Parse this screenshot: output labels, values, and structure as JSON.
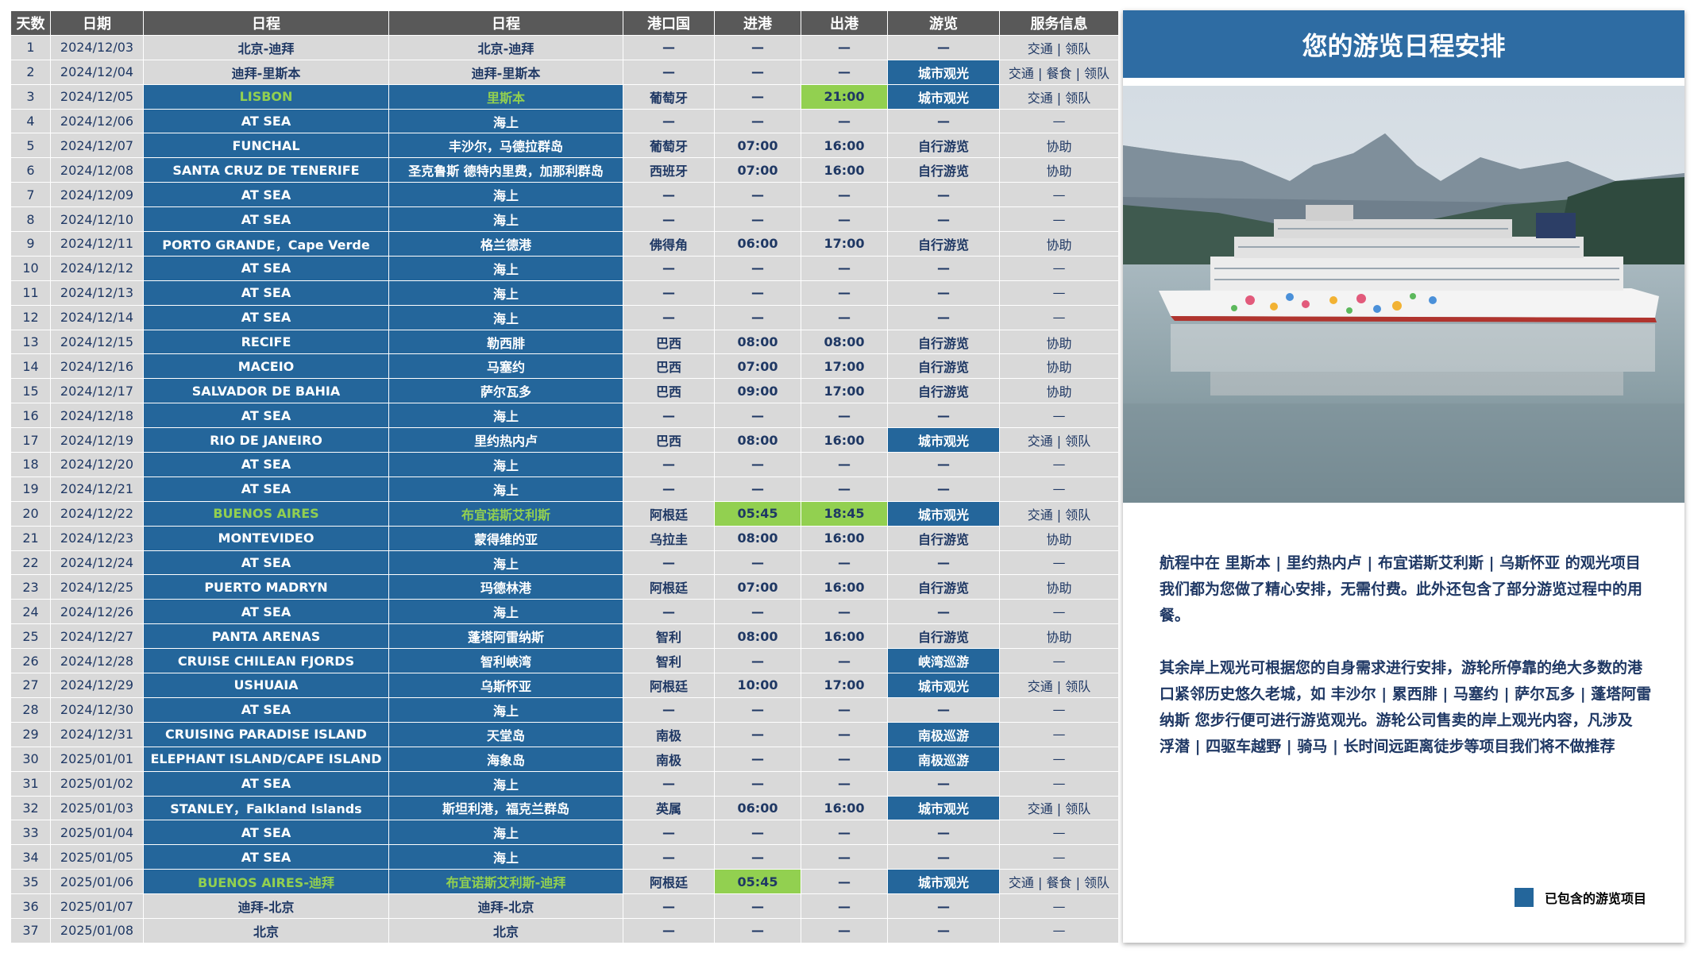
{
  "table": {
    "headers": [
      "天数",
      "日期",
      "日程",
      "日程",
      "港口国",
      "进港",
      "出港",
      "游览",
      "服务信息"
    ],
    "rows": [
      {
        "day": "1",
        "date": "2024/12/03",
        "en": "北京-迪拜",
        "cn": "北京-迪拜",
        "country": "—",
        "arrive": "—",
        "depart": "—",
        "tour": "—",
        "service": "交通 | 领队",
        "style": "plain"
      },
      {
        "day": "2",
        "date": "2024/12/04",
        "en": "迪拜-里斯本",
        "cn": "迪拜-里斯本",
        "country": "—",
        "arrive": "—",
        "depart": "—",
        "tour": "城市观光",
        "service": "交通 | 餐食 | 领队",
        "style": "plain",
        "tourHi": true
      },
      {
        "day": "3",
        "date": "2024/12/05",
        "en": "LISBON",
        "cn": "里斯本",
        "country": "葡萄牙",
        "arrive": "—",
        "depart": "21:00",
        "tour": "城市观光",
        "service": "交通 | 领队",
        "style": "highlight",
        "departHi": true,
        "tourHi": true
      },
      {
        "day": "4",
        "date": "2024/12/06",
        "en": "AT SEA",
        "cn": "海上",
        "country": "—",
        "arrive": "—",
        "depart": "—",
        "tour": "—",
        "service": "—",
        "style": "sea"
      },
      {
        "day": "5",
        "date": "2024/12/07",
        "en": "FUNCHAL",
        "cn": "丰沙尔，马德拉群岛",
        "country": "葡萄牙",
        "arrive": "07:00",
        "depart": "16:00",
        "tour": "自行游览",
        "service": "协助",
        "style": "sea"
      },
      {
        "day": "6",
        "date": "2024/12/08",
        "en": "SANTA CRUZ DE TENERIFE",
        "cn": "圣克鲁斯 德特内里费，加那利群岛",
        "country": "西班牙",
        "arrive": "07:00",
        "depart": "16:00",
        "tour": "自行游览",
        "service": "协助",
        "style": "sea"
      },
      {
        "day": "7",
        "date": "2024/12/09",
        "en": "AT SEA",
        "cn": "海上",
        "country": "—",
        "arrive": "—",
        "depart": "—",
        "tour": "—",
        "service": "—",
        "style": "sea"
      },
      {
        "day": "8",
        "date": "2024/12/10",
        "en": "AT SEA",
        "cn": "海上",
        "country": "—",
        "arrive": "—",
        "depart": "—",
        "tour": "—",
        "service": "—",
        "style": "sea"
      },
      {
        "day": "9",
        "date": "2024/12/11",
        "en": "PORTO GRANDE，Cape Verde",
        "cn": "格兰德港",
        "country": "佛得角",
        "arrive": "06:00",
        "depart": "17:00",
        "tour": "自行游览",
        "service": "协助",
        "style": "sea"
      },
      {
        "day": "10",
        "date": "2024/12/12",
        "en": "AT SEA",
        "cn": "海上",
        "country": "—",
        "arrive": "—",
        "depart": "—",
        "tour": "—",
        "service": "—",
        "style": "sea"
      },
      {
        "day": "11",
        "date": "2024/12/13",
        "en": "AT SEA",
        "cn": "海上",
        "country": "—",
        "arrive": "—",
        "depart": "—",
        "tour": "—",
        "service": "—",
        "style": "sea"
      },
      {
        "day": "12",
        "date": "2024/12/14",
        "en": "AT SEA",
        "cn": "海上",
        "country": "—",
        "arrive": "—",
        "depart": "—",
        "tour": "—",
        "service": "—",
        "style": "sea"
      },
      {
        "day": "13",
        "date": "2024/12/15",
        "en": "RECIFE",
        "cn": "勒西腓",
        "country": "巴西",
        "arrive": "08:00",
        "depart": "08:00",
        "tour": "自行游览",
        "service": "协助",
        "style": "sea"
      },
      {
        "day": "14",
        "date": "2024/12/16",
        "en": "MACEIO",
        "cn": "马塞约",
        "country": "巴西",
        "arrive": "07:00",
        "depart": "17:00",
        "tour": "自行游览",
        "service": "协助",
        "style": "sea"
      },
      {
        "day": "15",
        "date": "2024/12/17",
        "en": "SALVADOR DE BAHIA",
        "cn": "萨尔瓦多",
        "country": "巴西",
        "arrive": "09:00",
        "depart": "17:00",
        "tour": "自行游览",
        "service": "协助",
        "style": "sea"
      },
      {
        "day": "16",
        "date": "2024/12/18",
        "en": "AT SEA",
        "cn": "海上",
        "country": "—",
        "arrive": "—",
        "depart": "—",
        "tour": "—",
        "service": "—",
        "style": "sea"
      },
      {
        "day": "17",
        "date": "2024/12/19",
        "en": "RIO DE JANEIRO",
        "cn": "里约热内卢",
        "country": "巴西",
        "arrive": "08:00",
        "depart": "16:00",
        "tour": "城市观光",
        "service": "交通 | 领队",
        "style": "sea",
        "tourHi": true
      },
      {
        "day": "18",
        "date": "2024/12/20",
        "en": "AT SEA",
        "cn": "海上",
        "country": "—",
        "arrive": "—",
        "depart": "—",
        "tour": "—",
        "service": "—",
        "style": "sea"
      },
      {
        "day": "19",
        "date": "2024/12/21",
        "en": "AT SEA",
        "cn": "海上",
        "country": "—",
        "arrive": "—",
        "depart": "—",
        "tour": "—",
        "service": "—",
        "style": "sea"
      },
      {
        "day": "20",
        "date": "2024/12/22",
        "en": "BUENOS AIRES",
        "cn": "布宜诺斯艾利斯",
        "country": "阿根廷",
        "arrive": "05:45",
        "depart": "18:45",
        "tour": "城市观光",
        "service": "交通 | 领队",
        "style": "highlight",
        "arriveHi": true,
        "departHi": true,
        "tourHi": true
      },
      {
        "day": "21",
        "date": "2024/12/23",
        "en": "MONTEVIDEO",
        "cn": "蒙得维的亚",
        "country": "乌拉圭",
        "arrive": "08:00",
        "depart": "16:00",
        "tour": "自行游览",
        "service": "协助",
        "style": "sea"
      },
      {
        "day": "22",
        "date": "2024/12/24",
        "en": "AT SEA",
        "cn": "海上",
        "country": "—",
        "arrive": "—",
        "depart": "—",
        "tour": "—",
        "service": "—",
        "style": "sea"
      },
      {
        "day": "23",
        "date": "2024/12/25",
        "en": "PUERTO MADRYN",
        "cn": "玛德林港",
        "country": "阿根廷",
        "arrive": "07:00",
        "depart": "16:00",
        "tour": "自行游览",
        "service": "协助",
        "style": "sea"
      },
      {
        "day": "24",
        "date": "2024/12/26",
        "en": "AT SEA",
        "cn": "海上",
        "country": "—",
        "arrive": "—",
        "depart": "—",
        "tour": "—",
        "service": "—",
        "style": "sea"
      },
      {
        "day": "25",
        "date": "2024/12/27",
        "en": "PANTA ARENAS",
        "cn": "蓬塔阿雷纳斯",
        "country": "智利",
        "arrive": "08:00",
        "depart": "16:00",
        "tour": "自行游览",
        "service": "协助",
        "style": "sea"
      },
      {
        "day": "26",
        "date": "2024/12/28",
        "en": "CRUISE CHILEAN FJORDS",
        "cn": "智利峡湾",
        "country": "智利",
        "arrive": "—",
        "depart": "—",
        "tour": "峡湾巡游",
        "service": "—",
        "style": "sea",
        "tourHi": true
      },
      {
        "day": "27",
        "date": "2024/12/29",
        "en": "USHUAIA",
        "cn": "乌斯怀亚",
        "country": "阿根廷",
        "arrive": "10:00",
        "depart": "17:00",
        "tour": "城市观光",
        "service": "交通 | 领队",
        "style": "sea",
        "tourHi": true
      },
      {
        "day": "28",
        "date": "2024/12/30",
        "en": "AT SEA",
        "cn": "海上",
        "country": "—",
        "arrive": "—",
        "depart": "—",
        "tour": "—",
        "service": "—",
        "style": "sea"
      },
      {
        "day": "29",
        "date": "2024/12/31",
        "en": "CRUISING PARADISE ISLAND",
        "cn": "天堂岛",
        "country": "南极",
        "arrive": "—",
        "depart": "—",
        "tour": "南极巡游",
        "service": "—",
        "style": "sea",
        "tourHi": true
      },
      {
        "day": "30",
        "date": "2025/01/01",
        "en": "ELEPHANT ISLAND/CAPE ISLAND",
        "cn": "海象岛",
        "country": "南极",
        "arrive": "—",
        "depart": "—",
        "tour": "南极巡游",
        "service": "—",
        "style": "sea",
        "tourHi": true
      },
      {
        "day": "31",
        "date": "2025/01/02",
        "en": "AT SEA",
        "cn": "海上",
        "country": "—",
        "arrive": "—",
        "depart": "—",
        "tour": "—",
        "service": "—",
        "style": "sea"
      },
      {
        "day": "32",
        "date": "2025/01/03",
        "en": "STANLEY，Falkland Islands",
        "cn": "斯坦利港，福克兰群岛",
        "country": "英属",
        "arrive": "06:00",
        "depart": "16:00",
        "tour": "城市观光",
        "service": "交通 | 领队",
        "style": "sea",
        "tourHi": true
      },
      {
        "day": "33",
        "date": "2025/01/04",
        "en": "AT SEA",
        "cn": "海上",
        "country": "—",
        "arrive": "—",
        "depart": "—",
        "tour": "—",
        "service": "—",
        "style": "sea"
      },
      {
        "day": "34",
        "date": "2025/01/05",
        "en": "AT SEA",
        "cn": "海上",
        "country": "—",
        "arrive": "—",
        "depart": "—",
        "tour": "—",
        "service": "—",
        "style": "sea"
      },
      {
        "day": "35",
        "date": "2025/01/06",
        "en": "BUENOS AIRES-迪拜",
        "cn": "布宜诺斯艾利斯-迪拜",
        "country": "阿根廷",
        "arrive": "05:45",
        "depart": "—",
        "tour": "城市观光",
        "service": "交通 | 餐食 | 领队",
        "style": "highlight",
        "arriveHi": true,
        "tourHi": true
      },
      {
        "day": "36",
        "date": "2025/01/07",
        "en": "迪拜-北京",
        "cn": "迪拜-北京",
        "country": "—",
        "arrive": "—",
        "depart": "—",
        "tour": "—",
        "service": "—",
        "style": "plain"
      },
      {
        "day": "37",
        "date": "2025/01/08",
        "en": "北京",
        "cn": "北京",
        "country": "—",
        "arrive": "—",
        "depart": "—",
        "tour": "—",
        "service": "—",
        "style": "plain"
      }
    ]
  },
  "panel": {
    "title": "您的游览日程安排",
    "paragraph1": "航程中在 里斯本 | 里约热内卢 | 布宜诺斯艾利斯 | 乌斯怀亚 的观光项目我们都为您做了精心安排，无需付费。此外还包含了部分游览过程中的用餐。",
    "paragraph2": "其余岸上观光可根据您的自身需求进行安排，游轮所停靠的绝大多数的港口紧邻历史悠久老城，如 丰沙尔 | 累西腓 | 马塞约 | 萨尔瓦多 | 蓬塔阿雷纳斯 您步行便可进行游览观光。游轮公司售卖的岸上观光内容，凡涉及 浮潜 | 四驱车越野 | 骑马 | 长时间远距离徒步等项目我们将不做推荐",
    "legend": "已包含的游览项目"
  },
  "colors": {
    "header_bg": "#595959",
    "row_bg": "#d9d9d9",
    "accent_blue": "#24669b",
    "accent_green": "#92d050",
    "text_navy": "#1f3864"
  }
}
